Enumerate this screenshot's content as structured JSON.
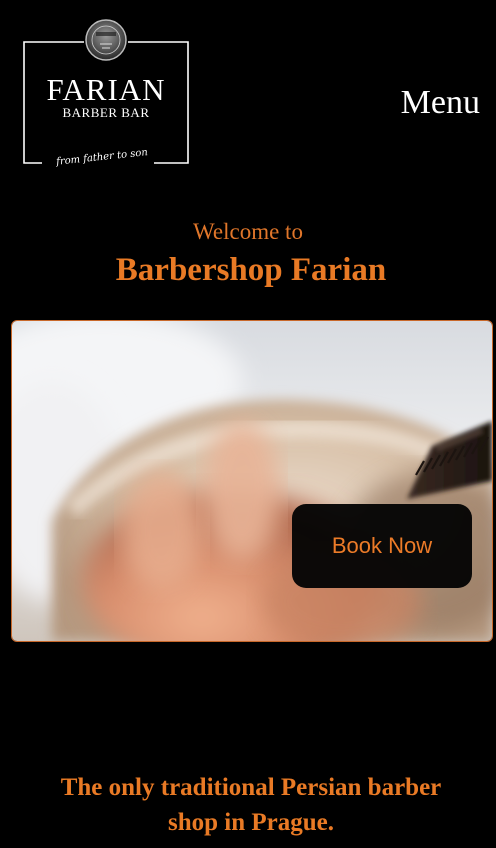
{
  "header": {
    "logo": {
      "title": "FARIAN",
      "subtitle": "BARBER BAR",
      "tagline": "from father to son"
    },
    "menu_label": "Menu"
  },
  "hero": {
    "welcome": "Welcome to",
    "title": "Barbershop Farian",
    "book_button_label": "Book Now"
  },
  "intro": {
    "tagline_line1": "The only traditional Persian barber",
    "tagline_line2": "shop in Prague."
  },
  "colors": {
    "background": "#000000",
    "accent_orange": "#e97a25",
    "text_white": "#ffffff"
  },
  "icons": {
    "logo_emblem": "barber-emblem-icon"
  }
}
